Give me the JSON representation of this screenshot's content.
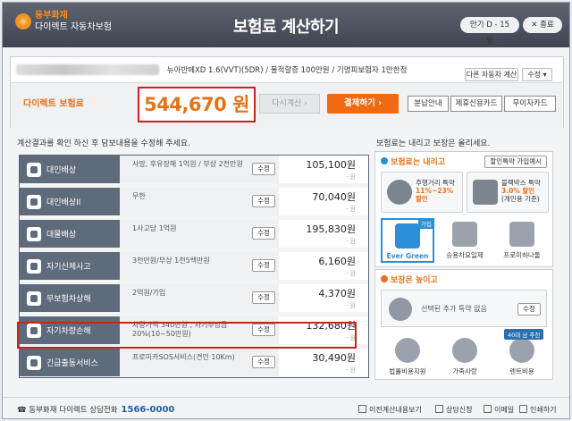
{
  "header": {
    "brand": "동부화재",
    "subtitle": "다이렉트 자동차보험",
    "title": "보험료 계산하기",
    "expiry_label": "만기 D - 15 일",
    "close_label": "종료"
  },
  "summary": {
    "car_info": "뉴아반떼XD 1.6(VVT)(5DR) / 물적할증 100만원 / 기명피보험자 1만한정",
    "calc_other_label": "다른 자동차 계산",
    "edit_label": "수정",
    "premium_label": "다이렉트 보험료",
    "premium_value": "544,670 원",
    "recalc_label": "다시계산",
    "subscribe_label": "결제하기",
    "installment_label": "분납안내",
    "card_label": "제휴신용카드",
    "interest_free_label": "무이자카드"
  },
  "left_caption": "계산결과를 확인 하신 후 담보내용을 수정해 주세요.",
  "coverages": [
    {
      "name": "대인배상",
      "desc": "사망, 후유장해 1억원 / 부상 2천만원",
      "amount": "105,100원",
      "dash": "- 원"
    },
    {
      "name": "대인배상II",
      "desc": "무한",
      "amount": "70,040원",
      "dash": "- 원"
    },
    {
      "name": "대물배상",
      "desc": "1사고당 1억원",
      "amount": "195,830원",
      "dash": "- 원"
    },
    {
      "name": "자기신체사고",
      "desc": "3천만원/부상 1천5백만원",
      "amount": "6,160원",
      "dash": "- 원"
    },
    {
      "name": "무보험차상해",
      "desc": "2억원/가입",
      "amount": "4,370원",
      "dash": "- 원"
    },
    {
      "name": "자기차량손해",
      "desc": "차량가액 340만원 , 자기부담금 20%(10~50만원)",
      "amount": "132,680원",
      "dash": "- 원"
    },
    {
      "name": "긴급출동서비스",
      "desc": "프로미카SOS서비스(견인 10Km)",
      "amount": "30,490원",
      "dash": "- 원"
    }
  ],
  "edit_small_label": "수정",
  "right_caption": "보험료는 내리고 보장은 올리세요.",
  "panel_lower": {
    "title": "보험료는 내리고",
    "discount_btn": "할인특약 가입예시",
    "features": [
      {
        "title": "주행거리 특약",
        "highlight": "11%~23%",
        "note": "할인"
      },
      {
        "title": "블랙박스 특약",
        "highlight": "3.0% 할인",
        "note": "(개인용 기준)"
      }
    ],
    "tiles": [
      {
        "label": "Ever Green",
        "badge": "가입"
      },
      {
        "label": "승용차요일제"
      },
      {
        "label": "프로미하나둘"
      }
    ]
  },
  "panel_upper": {
    "title": "보장은 높이고",
    "inline_text": "선택된 추가 특약 없음",
    "inline_edit": "수정",
    "tiles": [
      {
        "label": "법률비용지원"
      },
      {
        "label": "가족사랑"
      },
      {
        "label": "렌트비용",
        "badge": "40대 남 추천"
      }
    ]
  },
  "footer": {
    "phone_label": "동부화재 다이렉트 상담전화",
    "phone_number": "1566-0000",
    "links": [
      "이전계산내용보기",
      "상담신청",
      "이메일",
      "인쇄하기"
    ]
  }
}
